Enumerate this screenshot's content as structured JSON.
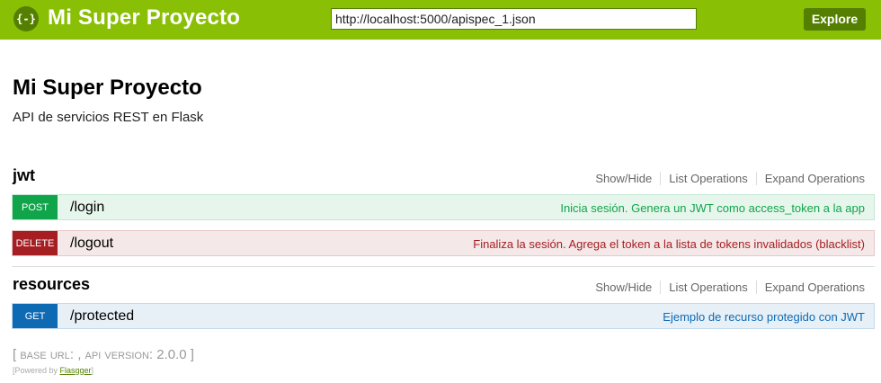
{
  "header": {
    "logo_text": "{-}",
    "title": "Mi Super Proyecto",
    "url_value": "http://localhost:5000/apispec_1.json",
    "explore_label": "Explore",
    "brand_color": "#89bf04",
    "dark_brand_color": "#547f00"
  },
  "info": {
    "title": "Mi Super Proyecto",
    "description": "API de servicios REST en Flask"
  },
  "resources": [
    {
      "name": "jwt",
      "controls": [
        "Show/Hide",
        "List Operations",
        "Expand Operations"
      ],
      "operations": [
        {
          "method": "POST",
          "path": "/login",
          "summary": "Inicia sesión. Genera un JWT como access_token a la app",
          "color": "#10a54a"
        },
        {
          "method": "DELETE",
          "path": "/logout",
          "summary": "Finaliza la sesión. Agrega el token a la lista de tokens invalidados (blacklist)",
          "color": "#a41e22"
        }
      ]
    },
    {
      "name": "resources",
      "controls": [
        "Show/Hide",
        "List Operations",
        "Expand Operations"
      ],
      "operations": [
        {
          "method": "GET",
          "path": "/protected",
          "summary": "Ejemplo de recurso protegido con JWT",
          "color": "#0f6ab4"
        }
      ]
    }
  ],
  "footer": {
    "base_url_text": "[ base url: , api version: 2.0.0 ]",
    "powered_prefix": "[Powered by ",
    "powered_link": "Flasgger",
    "powered_suffix": "]"
  }
}
